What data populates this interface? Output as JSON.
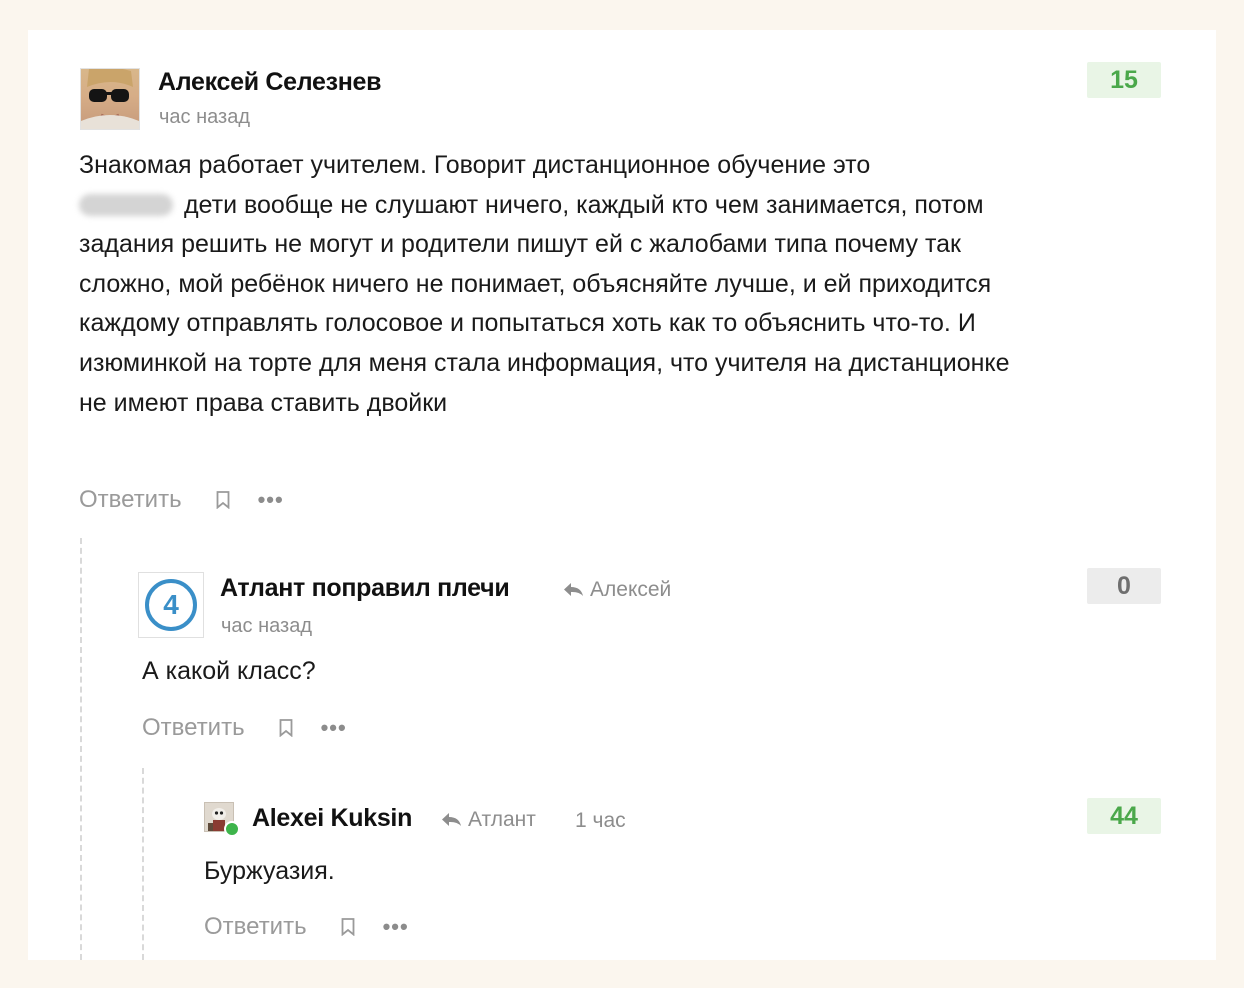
{
  "colors": {
    "page_background": "#fbf6ee",
    "positive_score_bg": "#e9f5e6",
    "positive_score_text": "#4aa84a",
    "zero_score_bg": "#ececec",
    "online_indicator": "#3db44b",
    "avatar_badge_blue": "#3a8fc8"
  },
  "comments": [
    {
      "author": "Алексей Селезнев",
      "time": "час назад",
      "score": "15",
      "text_first_line": "Знакомая работает учителем. Говорит дистанционное обучение это",
      "text_rest": "дети вообще не слушают ничего, каждый кто чем занимается, потом задания решить не могут и родители пишут ей с жалобами типа почему так сложно, мой ребёнок ничего не понимает, объясняйте лучше, и ей приходится каждому отправлять голосовое и попытаться хоть как то объяснить что-то. И изюминкой на торте для меня стала информация, что учителя на дистанционке не имеют права ставить двойки",
      "reply_label": "Ответить"
    },
    {
      "author": "Атлант поправил плечи",
      "avatar_badge": "4",
      "reply_to": "Алексей",
      "time": "час назад",
      "score": "0",
      "text": "А какой класс?",
      "reply_label": "Ответить"
    },
    {
      "author": "Alexei Kuksin",
      "reply_to": "Атлант",
      "time": "1 час",
      "score": "44",
      "text": "Буржуазия.",
      "reply_label": "Ответить"
    }
  ],
  "icons": {
    "bookmark": "bookmark-icon",
    "more": "more-icon",
    "reply_arrow": "reply-arrow-icon",
    "more_glyph": "•••"
  }
}
